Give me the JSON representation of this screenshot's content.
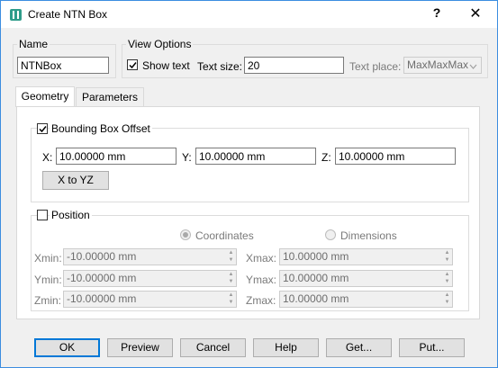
{
  "window": {
    "title": "Create NTN Box",
    "help_label": "?",
    "close_label": "✕"
  },
  "name_group": {
    "legend": "Name",
    "value": "NTNBox"
  },
  "view_options": {
    "legend": "View Options",
    "show_text_label": "Show text",
    "show_text_checked": true,
    "text_size_label": "Text size:",
    "text_size_value": "20",
    "text_place_label": "Text place:",
    "text_place_value": "MaxMaxMax"
  },
  "tabs": [
    {
      "label": "Geometry",
      "active": true
    },
    {
      "label": "Parameters",
      "active": false
    }
  ],
  "bounding_box": {
    "legend": "Bounding Box Offset",
    "checked": true,
    "x_label": "X:",
    "x_value": "10.00000 mm",
    "y_label": "Y:",
    "y_value": "10.00000 mm",
    "z_label": "Z:",
    "z_value": "10.00000 mm",
    "x_to_yz_label": "X to YZ"
  },
  "position": {
    "legend": "Position",
    "checked": false,
    "coordinates_label": "Coordinates",
    "dimensions_label": "Dimensions",
    "xmin_label": "Xmin:",
    "xmin_value": "-10.00000 mm",
    "ymin_label": "Ymin:",
    "ymin_value": "-10.00000 mm",
    "zmin_label": "Zmin:",
    "zmin_value": "-10.00000 mm",
    "xmax_label": "Xmax:",
    "xmax_value": "10.00000 mm",
    "ymax_label": "Ymax:",
    "ymax_value": "10.00000 mm",
    "zmax_label": "Zmax:",
    "zmax_value": "10.00000 mm"
  },
  "buttons": {
    "ok": "OK",
    "preview": "Preview",
    "cancel": "Cancel",
    "help": "Help",
    "get": "Get...",
    "put": "Put..."
  },
  "colors": {
    "accent": "#0078d7",
    "window_border": "#3c8de0",
    "app_icon": "#2e9c8a"
  },
  "icons": {
    "app": "ntn-box-app-icon",
    "check": "checkmark-icon",
    "spin": "spin-arrows-icon",
    "dropdown": "chevron-down-icon"
  }
}
